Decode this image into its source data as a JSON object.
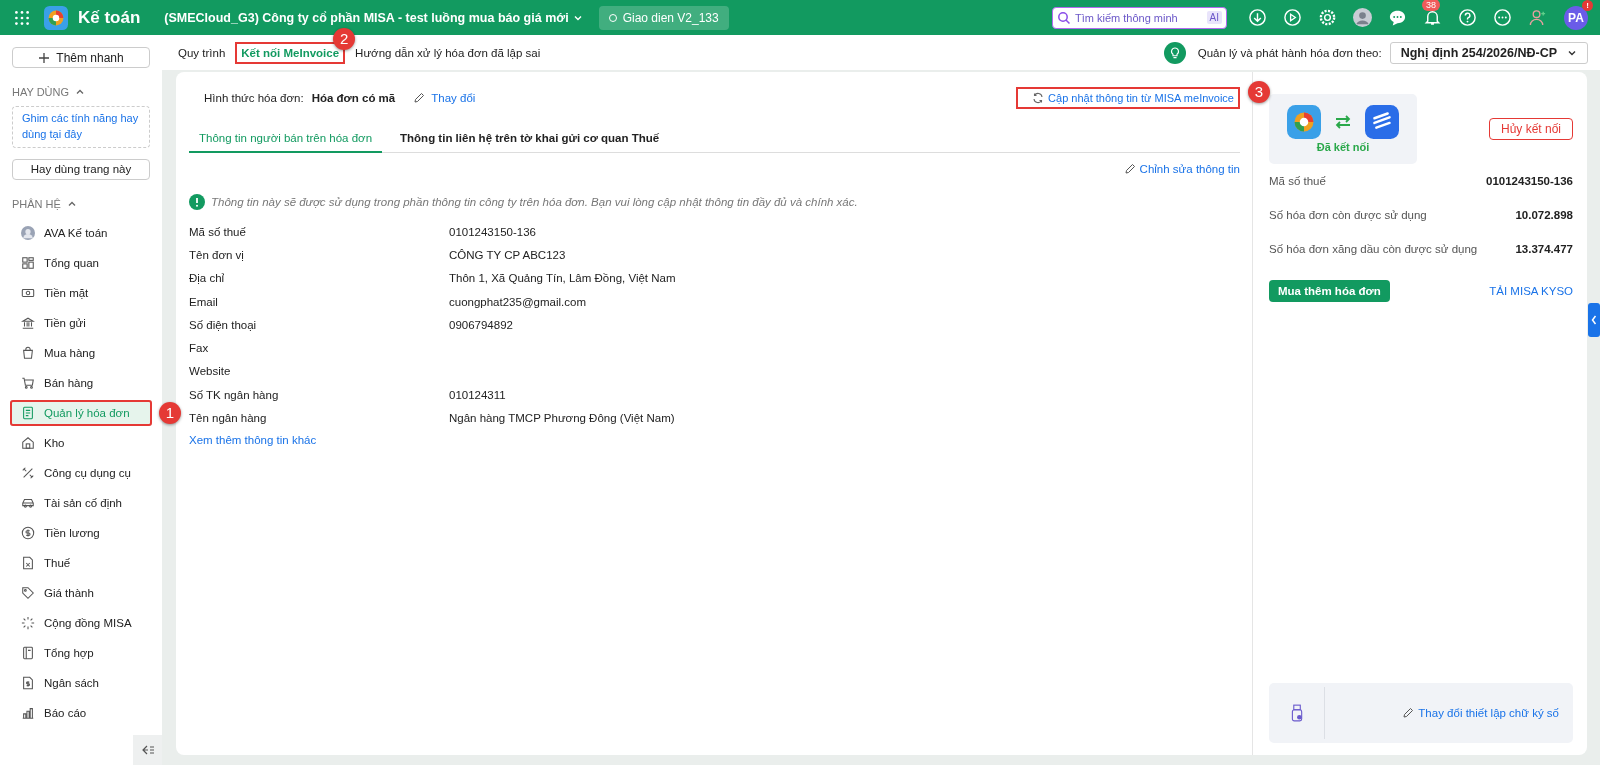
{
  "app_bar": {
    "app_name": "Kế toán",
    "company": "(SMECloud_G3) Công ty cổ phần MISA - test luồng mua báo giá mới",
    "version_chip": "Giao dien V2_133",
    "search": {
      "placeholder": "Tìm kiếm thông minh",
      "ai_badge": "AI"
    },
    "notification_count": "38",
    "avatar_initials": "PA",
    "avatar_badge": "!"
  },
  "sidebar": {
    "quick_add": "Thêm nhanh",
    "favorites_heading": "HAY DÙNG",
    "favorites_expanded": true,
    "favorites_hint": "Ghim các tính năng hay dùng tại đây",
    "pin_button": "Hay dùng trang này",
    "modules_heading": "PHÂN HỆ",
    "modules_expanded": true,
    "items": [
      {
        "label": "AVA Kế toán",
        "selected": false
      },
      {
        "label": "Tổng quan",
        "selected": false
      },
      {
        "label": "Tiền mặt",
        "selected": false
      },
      {
        "label": "Tiền gửi",
        "selected": false
      },
      {
        "label": "Mua hàng",
        "selected": false
      },
      {
        "label": "Bán hàng",
        "selected": false
      },
      {
        "label": "Quản lý hóa đơn",
        "selected": true,
        "callout": "1"
      },
      {
        "label": "Kho",
        "selected": false
      },
      {
        "label": "Công cụ dụng cụ",
        "selected": false
      },
      {
        "label": "Tài sản cố định",
        "selected": false
      },
      {
        "label": "Tiền lương",
        "selected": false
      },
      {
        "label": "Thuế",
        "selected": false
      },
      {
        "label": "Giá thành",
        "selected": false
      },
      {
        "label": "Cộng đồng MISA",
        "selected": false
      },
      {
        "label": "Tổng hợp",
        "selected": false
      },
      {
        "label": "Ngân sách",
        "selected": false
      },
      {
        "label": "Báo cáo",
        "selected": false
      }
    ]
  },
  "subtabs": [
    {
      "label": "Quy trình",
      "selected": false
    },
    {
      "label": "Kết nối MeInvoice",
      "selected": true,
      "callout": "2"
    },
    {
      "label": "Hướng dẫn xử lý hóa đơn đã lập sai",
      "selected": false
    }
  ],
  "decree": {
    "label": "Quản lý và phát hành hóa đơn theo:",
    "value": "Nghị định 254/2026/NĐ-CP"
  },
  "invoice_form": {
    "label": "Hình thức hóa đơn:",
    "value": "Hóa đơn có mã",
    "change_link": "Thay đổi"
  },
  "update_link": {
    "label": "Cập nhật thông tin từ MISA meInvoice",
    "callout": "3"
  },
  "info_tabs": [
    {
      "label": "Thông tin người bán trên hóa đơn",
      "selected": true
    },
    {
      "label": "Thông tin liên hệ trên tờ khai gửi cơ quan Thuế",
      "selected": false
    }
  ],
  "edit_link": "Chỉnh sửa thông tin",
  "notice": "Thông tin này sẽ được sử dụng trong phần thông tin công ty trên hóa đơn. Bạn vui lòng cập nhật thông tin đầy đủ và chính xác.",
  "fields": [
    {
      "label": "Mã số thuế",
      "value": "0101243150-136"
    },
    {
      "label": "Tên đơn vị",
      "value": "CÔNG TY CP ABC123"
    },
    {
      "label": "Địa chỉ",
      "value": "Thôn 1, Xã Quảng Tín, Lâm Đồng, Việt Nam"
    },
    {
      "label": "Email",
      "value": "cuongphat235@gmail.com"
    },
    {
      "label": "Số điện thoại",
      "value": "0906794892"
    },
    {
      "label": "Fax"
    },
    {
      "label": "Website"
    },
    {
      "label": "Số TK ngân hàng",
      "value": "010124311"
    },
    {
      "label": "Tên ngân hàng",
      "value": "Ngân hàng TMCP Phương Đông (Việt Nam)"
    }
  ],
  "more_link": "Xem thêm thông tin khác",
  "connection": {
    "status": "Đã kết nối",
    "disconnect_button": "Hủy kết nối",
    "stats": [
      {
        "label": "Mã số thuế",
        "value": "0101243150-136"
      },
      {
        "label": "Số hóa đơn còn được sử dụng",
        "value": "10.072.898"
      },
      {
        "label": "Số hóa đơn xăng dầu còn được sử dụng",
        "value": "13.374.477"
      }
    ],
    "buy_button": "Mua thêm hóa đơn",
    "download_link": "TẢI MISA KYSO",
    "signature_link": "Thay đổi thiết lập chữ ký số"
  }
}
